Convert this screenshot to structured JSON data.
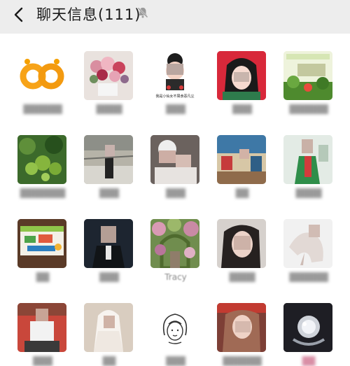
{
  "header": {
    "title": "聊天信息(111)",
    "back_icon": "chevron-left-icon",
    "mute_icon": "bell-muted-icon"
  },
  "members": [
    {
      "name": "",
      "avatar": "logo"
    },
    {
      "name": "",
      "avatar": "flowers"
    },
    {
      "name": "",
      "avatar": "cartoon-girl-caption",
      "caption": "我是小仙女不屑食恶凡尘"
    },
    {
      "name": "",
      "avatar": "cartoon-girl-red"
    },
    {
      "name": "",
      "avatar": "green-poster"
    },
    {
      "name": "",
      "avatar": "green-fruit"
    },
    {
      "name": "",
      "avatar": "person-outdoor"
    },
    {
      "name": "",
      "avatar": "selfie-couple"
    },
    {
      "name": "",
      "avatar": "classroom"
    },
    {
      "name": "",
      "avatar": "person-green"
    },
    {
      "name": "",
      "avatar": "sign-board"
    },
    {
      "name": "",
      "avatar": "suit-man"
    },
    {
      "name": "Tracy",
      "avatar": "garden-arch"
    },
    {
      "name": "",
      "avatar": "woman-portrait"
    },
    {
      "name": "",
      "avatar": "dancer"
    },
    {
      "name": "",
      "avatar": "child-red"
    },
    {
      "name": "",
      "avatar": "bride"
    },
    {
      "name": "",
      "avatar": "sketch-girl"
    },
    {
      "name": "",
      "avatar": "woman-red"
    },
    {
      "name": "",
      "avatar": "ring"
    }
  ]
}
